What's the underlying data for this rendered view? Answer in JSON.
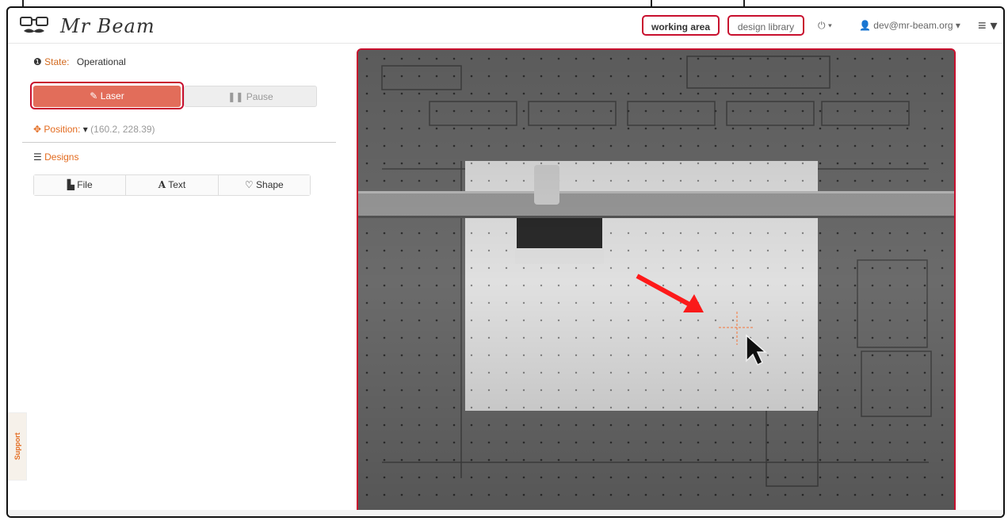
{
  "header": {
    "logo_text": "Mr Beam",
    "nav": {
      "working_area": "working area",
      "design_library": "design library",
      "power": "⏻ ▾",
      "user": "👤 dev@mr-beam.org ▾",
      "menu": "≡ ▾"
    }
  },
  "sidebar": {
    "state_label": "State:",
    "state_value": "Operational",
    "laser_label": "Laser",
    "pause_label": "Pause",
    "position_label": "Position:",
    "position_value": "(160.2, 228.39)",
    "designs_label": "Designs",
    "buttons": {
      "file": "File",
      "text": "Text",
      "shape": "Shape"
    }
  },
  "support_label": "Support",
  "camera": {
    "accent": "#ff0000"
  }
}
